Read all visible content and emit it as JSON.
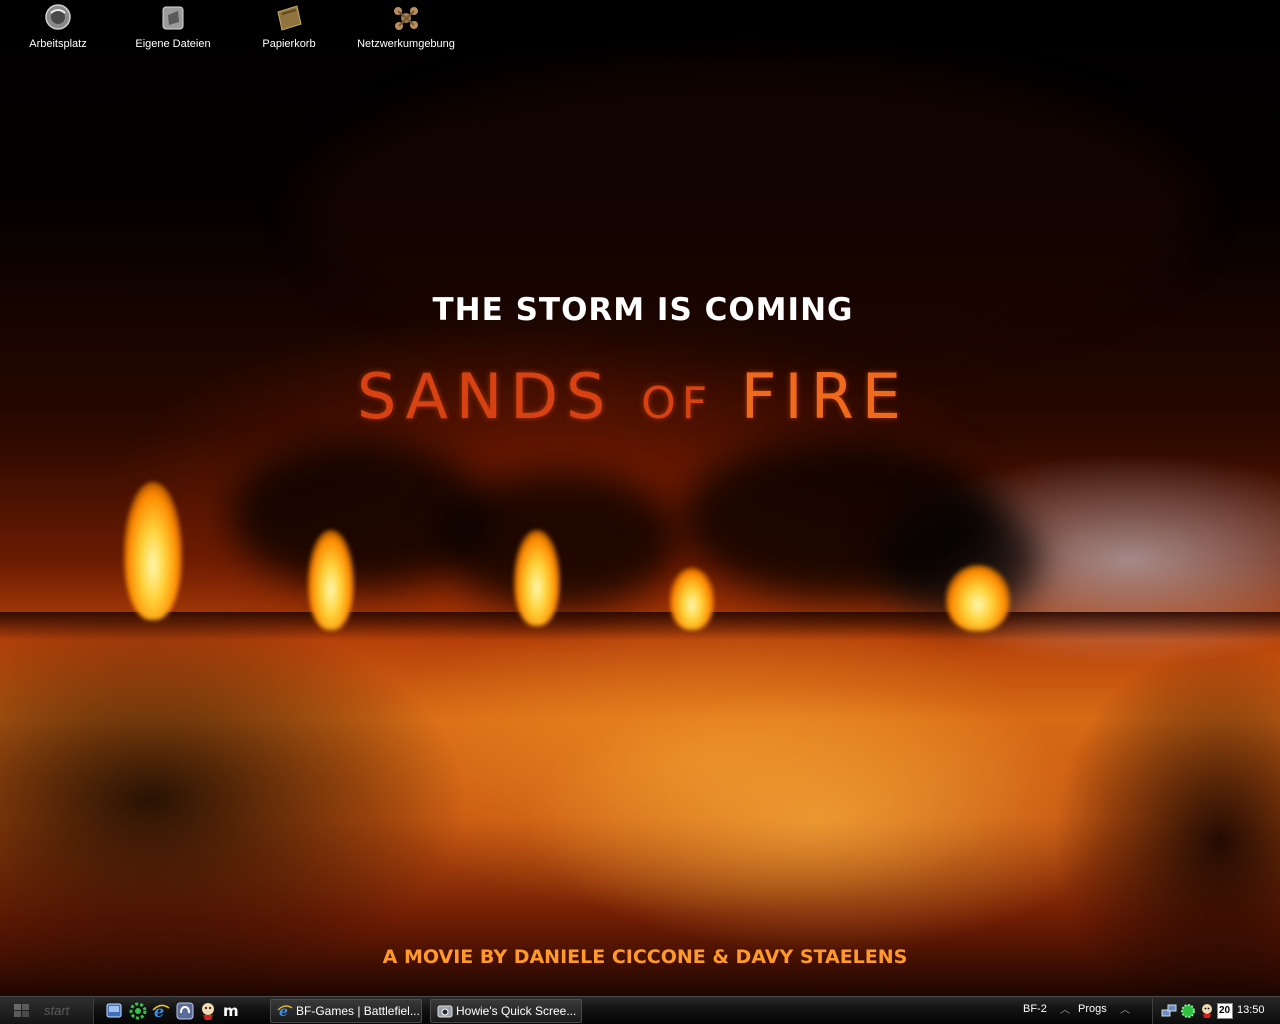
{
  "desktop": {
    "icons": [
      {
        "label": "Arbeitsplatz",
        "icon": "my-computer-icon"
      },
      {
        "label": "Eigene Dateien",
        "icon": "my-documents-icon"
      },
      {
        "label": "Papierkorb",
        "icon": "recycle-bin-icon"
      },
      {
        "label": "Netzwerkumgebung",
        "icon": "network-places-icon"
      }
    ]
  },
  "wallpaper": {
    "tagline": "THE STORM IS COMING",
    "title_part1": "SANDS ",
    "title_part2": "OF",
    "title_part3": " FIRE",
    "credit": "A MOVIE BY DANIELE CICCONE & DAVY STAELENS"
  },
  "taskbar": {
    "start_label": "start",
    "quick_launch": [
      "show-desktop-icon",
      "settings-icon",
      "internet-explorer-icon",
      "media-player-icon",
      "messenger-icon",
      "m-app-icon"
    ],
    "tasks": [
      {
        "label": "BF-Games | Battlefiel...",
        "icon": "internet-explorer-icon"
      },
      {
        "label": "Howie's Quick Scree...",
        "icon": "camera-icon"
      }
    ],
    "toolbars": [
      "BF-2",
      "Progs"
    ],
    "tray": {
      "icons": [
        "network-icon",
        "antivirus-icon",
        "messenger-icon",
        "calendar-icon"
      ],
      "calendar_day": "20",
      "clock": "13:50"
    }
  },
  "colors": {
    "title_red": "#d84212",
    "credit_orange": "#ff9a2a",
    "taskbar_black": "#121212"
  }
}
